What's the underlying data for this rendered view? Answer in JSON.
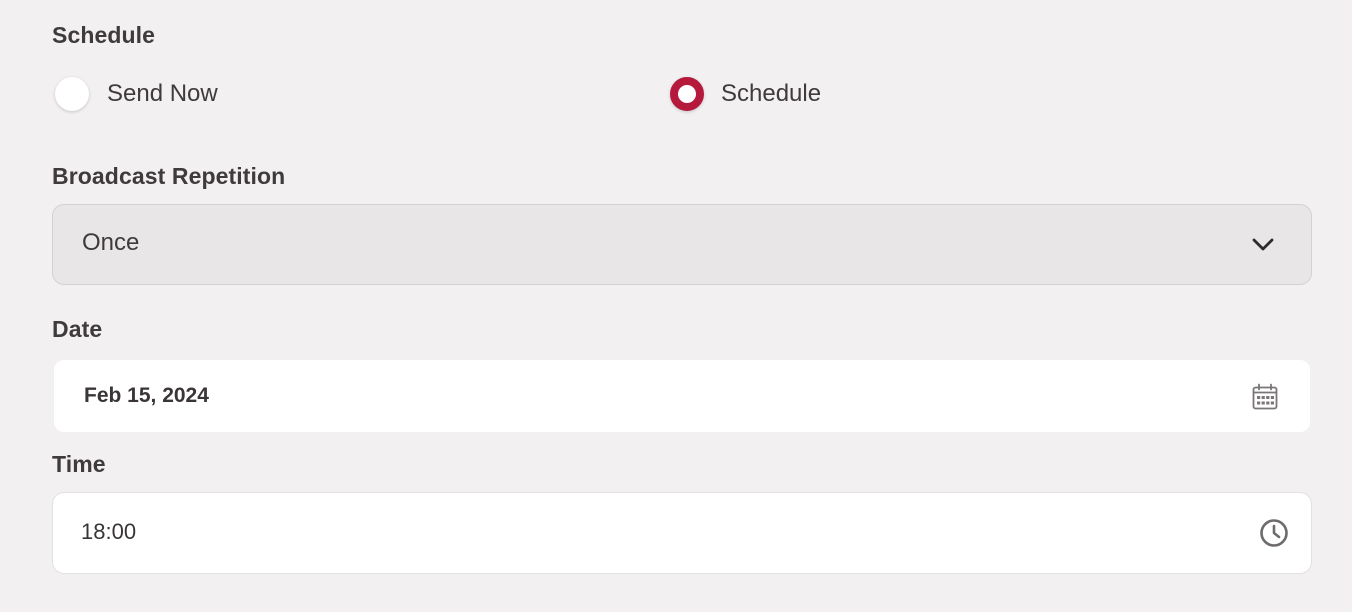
{
  "schedule": {
    "label": "Schedule",
    "options": [
      {
        "label": "Send Now",
        "selected": false
      },
      {
        "label": "Schedule",
        "selected": true
      }
    ],
    "accent_color": "#b51a3c"
  },
  "repetition": {
    "label": "Broadcast Repetition",
    "selected": "Once",
    "icon": "chevron-down-icon"
  },
  "date": {
    "label": "Date",
    "value": "Feb 15, 2024",
    "icon": "calendar-icon"
  },
  "time": {
    "label": "Time",
    "value": "18:00",
    "icon": "clock-icon"
  }
}
